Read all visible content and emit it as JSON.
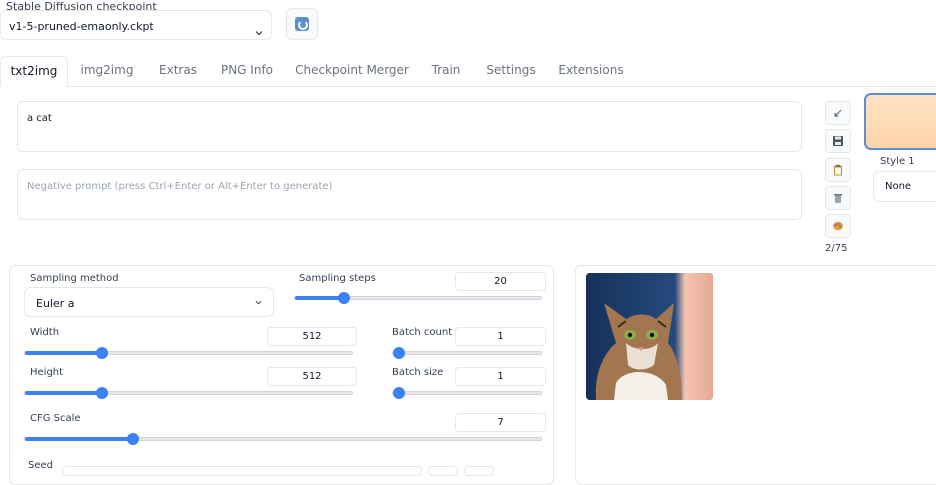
{
  "checkpoint": {
    "label": "Stable Diffusion checkpoint",
    "value": "v1-5-pruned-emaonly.ckpt"
  },
  "tabs": [
    {
      "label": "txt2img",
      "active": true
    },
    {
      "label": "img2img"
    },
    {
      "label": "Extras"
    },
    {
      "label": "PNG Info"
    },
    {
      "label": "Checkpoint Merger"
    },
    {
      "label": "Train"
    },
    {
      "label": "Settings"
    },
    {
      "label": "Extensions"
    }
  ],
  "prompt": {
    "value": "a cat"
  },
  "negative_prompt": {
    "placeholder": "Negative prompt (press Ctrl+Enter or Alt+Enter to generate)"
  },
  "tools": {
    "token_count": "2/75"
  },
  "styles": {
    "label": "Style 1",
    "value": "None"
  },
  "params": {
    "sampling_method": {
      "label": "Sampling method",
      "value": "Euler a"
    },
    "sampling_steps": {
      "label": "Sampling steps",
      "value": "20",
      "fraction": 0.2
    },
    "width": {
      "label": "Width",
      "value": "512",
      "fraction": 0.235
    },
    "height": {
      "label": "Height",
      "value": "512",
      "fraction": 0.235
    },
    "batch_count": {
      "label": "Batch count",
      "value": "1",
      "fraction": 0.0
    },
    "batch_size": {
      "label": "Batch size",
      "value": "1",
      "fraction": 0.0
    },
    "cfg_scale": {
      "label": "CFG Scale",
      "value": "7",
      "fraction": 0.21
    },
    "seed": {
      "label": "Seed"
    }
  },
  "colors": {
    "accent": "#3b82f6",
    "generate_bg": "#fdd3a8"
  }
}
